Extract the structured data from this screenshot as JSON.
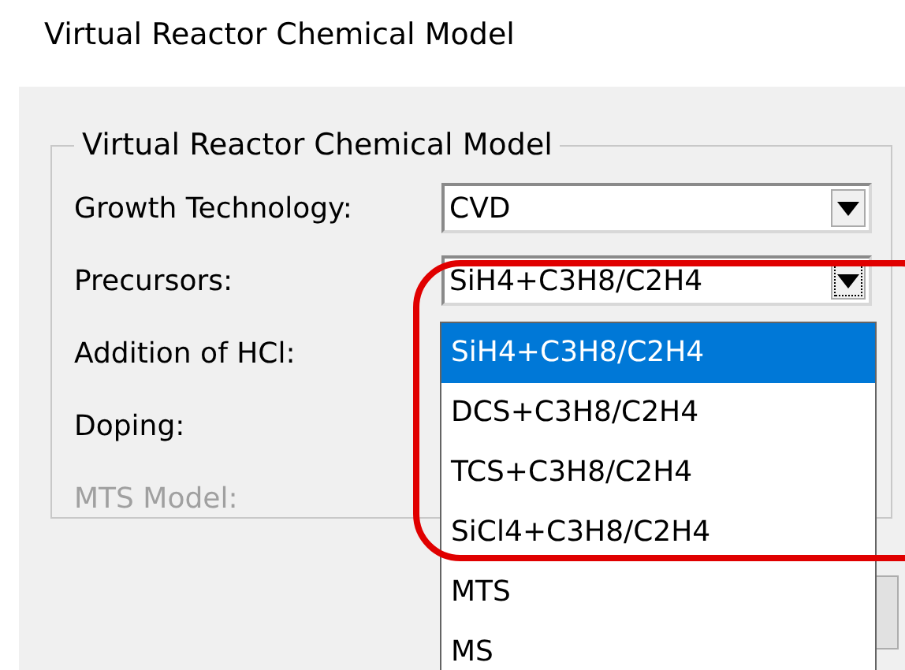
{
  "window": {
    "title": "Virtual Reactor Chemical Model"
  },
  "group": {
    "title": "Virtual Reactor Chemical Model",
    "fields": [
      {
        "kind": "combo",
        "label": "Growth Technology:",
        "disabled": false,
        "value": "CVD",
        "focused": false
      },
      {
        "kind": "combo",
        "label": "Precursors:",
        "disabled": false,
        "value": "SiH4+C3H8/C2H4",
        "focused": true
      },
      {
        "kind": "label",
        "label": "Addition of HCl:",
        "disabled": false
      },
      {
        "kind": "label",
        "label": "Doping:",
        "disabled": false
      },
      {
        "kind": "label",
        "label": "MTS Model:",
        "disabled": true
      }
    ]
  },
  "dropdown": {
    "items": [
      {
        "label": "SiH4+C3H8/C2H4",
        "selected": true
      },
      {
        "label": "DCS+C3H8/C2H4",
        "selected": false
      },
      {
        "label": "TCS+C3H8/C2H4",
        "selected": false
      },
      {
        "label": "SiCl4+C3H8/C2H4",
        "selected": false
      },
      {
        "label": "MTS",
        "selected": false
      },
      {
        "label": "MS",
        "selected": false
      }
    ]
  }
}
